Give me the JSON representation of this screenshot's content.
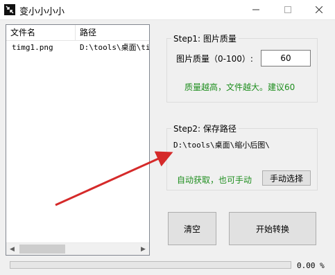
{
  "window": {
    "title": "变小小小小",
    "icons": {
      "app": "shrink-arrows-icon",
      "minimize": "minimize-icon",
      "maximize": "maximize-icon",
      "close": "close-icon"
    }
  },
  "file_list": {
    "columns": [
      "文件名",
      "路径"
    ],
    "rows": [
      {
        "name": "timg1.png",
        "path": "D:\\tools\\桌面\\tim"
      }
    ]
  },
  "step1": {
    "title": "Step1: 图片质量",
    "quality_label": "图片质量（0-100）:",
    "quality_value": "60",
    "hint": "质量越高，文件越大。建议60"
  },
  "step2": {
    "title": "Step2: 保存路径",
    "path": "D:\\tools\\桌面\\缩小后图\\",
    "hint": "自动获取，也可手动",
    "manual_button": "手动选择"
  },
  "actions": {
    "clear": "清空",
    "start": "开始转换"
  },
  "progress": {
    "value_fraction": 0,
    "text": "0.00 %"
  },
  "colors": {
    "hint_green": "#1e8e1e",
    "arrow_red": "#d52a2a"
  }
}
